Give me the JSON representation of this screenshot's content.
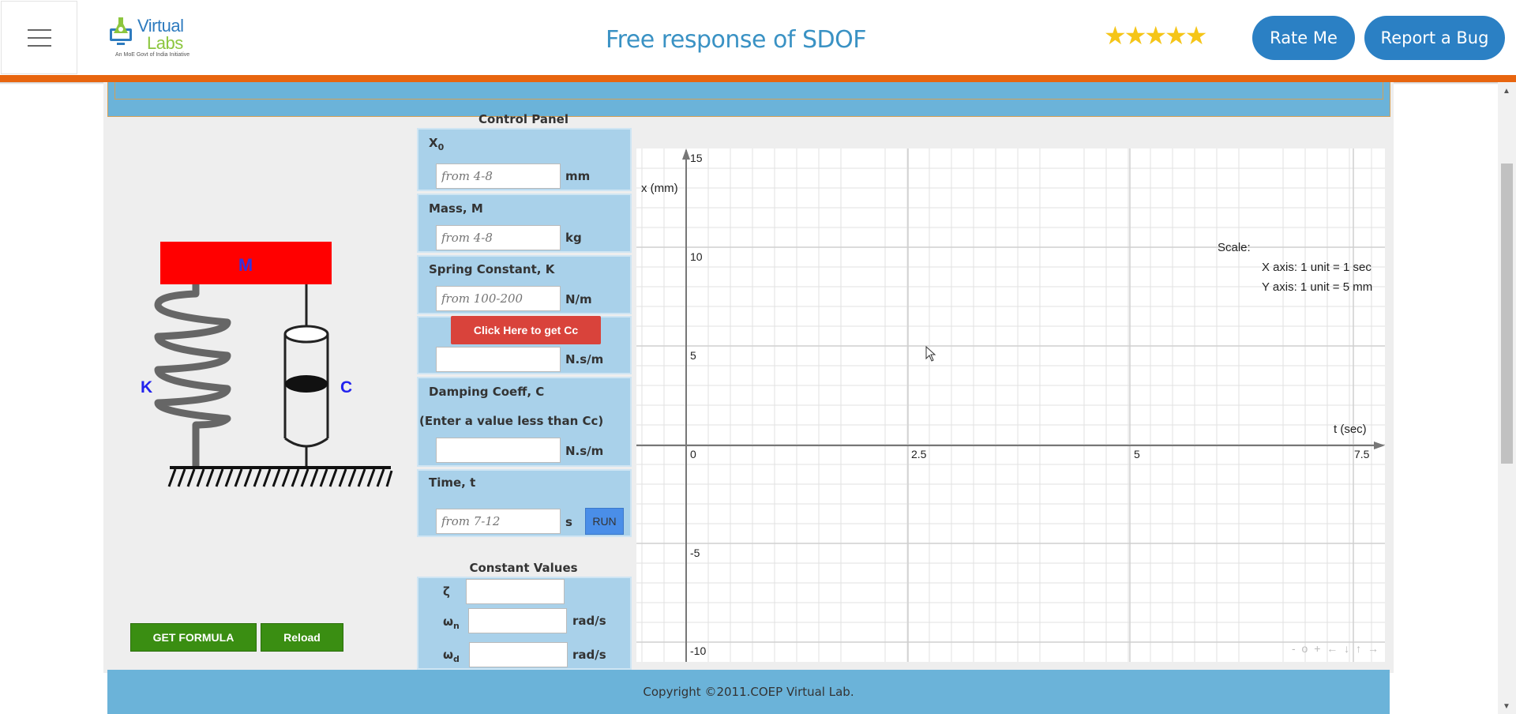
{
  "header": {
    "logo_line1": "Virtual",
    "logo_line2": "Labs",
    "logo_sub": "An MoE Govt of India Initiative",
    "title": "Free response of SDOF",
    "rating_stars": "★★★★★",
    "rate_button": "Rate Me",
    "bug_button": "Report a Bug"
  },
  "mechanism": {
    "mass_label": "M",
    "spring_label": "K",
    "damper_label": "C"
  },
  "control_panel": {
    "title": "Control Panel",
    "x0_label": "X",
    "x0_sub": "0",
    "x0_placeholder": "from 4-8",
    "x0_unit": "mm",
    "mass_label": "Mass, M",
    "mass_placeholder": "from 4-8",
    "mass_unit": "kg",
    "spring_label": "Spring Constant, K",
    "spring_placeholder": "from 100-200",
    "spring_unit": "N/m",
    "cc_button": "Click Here to get Cc",
    "cc_value": "",
    "cc_unit": "N.s/m",
    "damping_label": "Damping Coeff, C",
    "damping_note": "(Enter a value less than Cc)",
    "damping_value": "",
    "damping_unit": "N.s/m",
    "time_label": "Time, t",
    "time_placeholder": "from 7-12",
    "time_unit": "s",
    "run_button": "RUN"
  },
  "constants": {
    "title": "Constant Values",
    "zeta_symbol": "ζ",
    "wn_symbol": "ω",
    "wn_sub": "n",
    "wn_unit": "rad/s",
    "wd_symbol": "ω",
    "wd_sub": "d",
    "wd_unit": "rad/s"
  },
  "buttons": {
    "get_formula": "GET FORMULA",
    "reload": "Reload"
  },
  "graph": {
    "y_axis_label": "x (mm)",
    "x_axis_label": "t (sec)",
    "scale_title": "Scale:",
    "scale_x": "X axis: 1 unit = 1 sec",
    "scale_y": "Y axis: 1 unit = 5 mm",
    "y_ticks": [
      "15",
      "10",
      "5",
      "-5",
      "-10"
    ],
    "x_ticks": [
      "0",
      "2.5",
      "5",
      "7.5"
    ],
    "nav_controls": "- o + ← ↓ ↑ →"
  },
  "footer": {
    "copyright": "Copyright ©2011.COEP Virtual Lab."
  }
}
